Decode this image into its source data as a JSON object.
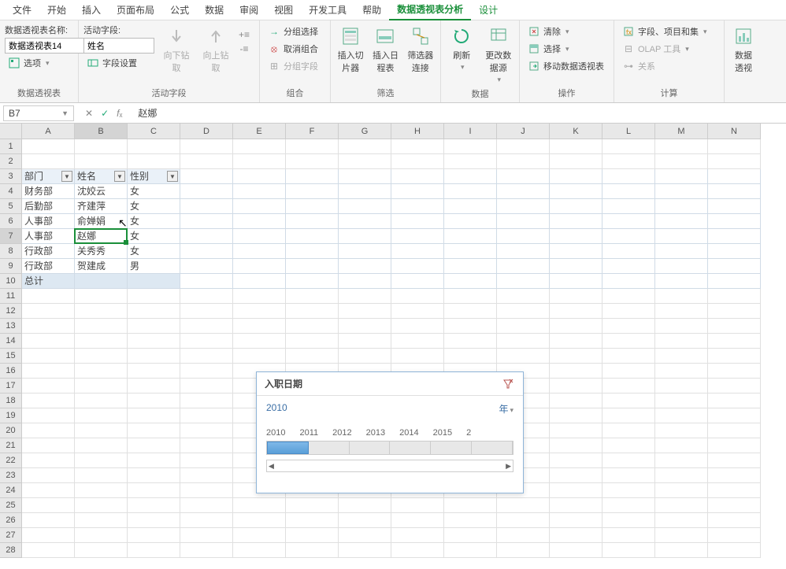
{
  "menu": [
    "文件",
    "开始",
    "插入",
    "页面布局",
    "公式",
    "数据",
    "审阅",
    "视图",
    "开发工具",
    "帮助",
    "数据透视表分析",
    "设计"
  ],
  "menu_active_index": 10,
  "ribbon": {
    "group1": {
      "label": "数据透视表",
      "name_lbl": "数据透视表名称:",
      "name_val": "数据透视表14",
      "options": "选项"
    },
    "group2": {
      "label": "活动字段",
      "field_lbl": "活动字段:",
      "field_val": "姓名",
      "settings": "字段设置",
      "drilldown": "向下钻取",
      "drillup": "向上钻取"
    },
    "group3": {
      "label": "组合",
      "group_sel": "分组选择",
      "ungroup": "取消组合",
      "group_field": "分组字段"
    },
    "group4": {
      "label": "筛选",
      "slicer": "插入切片器",
      "timeline": "插入日程表",
      "conn": "筛选器连接"
    },
    "group5": {
      "label": "数据",
      "refresh": "刷新",
      "change": "更改数据源"
    },
    "group6": {
      "label": "操作",
      "clear": "清除",
      "select": "选择",
      "move": "移动数据透视表"
    },
    "group7": {
      "label": "计算",
      "fields": "字段、项目和集",
      "olap": "OLAP 工具",
      "rel": "关系"
    },
    "group8": {
      "pivot": "数据透视"
    }
  },
  "namebox": "B7",
  "formula_val": "赵娜",
  "cols": [
    "A",
    "B",
    "C",
    "D",
    "E",
    "F",
    "G",
    "H",
    "I",
    "J",
    "K",
    "L",
    "M",
    "N"
  ],
  "rows_count": 28,
  "headers": {
    "dept": "部门",
    "name": "姓名",
    "gender": "性别"
  },
  "table": [
    {
      "dept": "财务部",
      "name": "沈姣云",
      "gender": "女"
    },
    {
      "dept": "后勤部",
      "name": "齐建萍",
      "gender": "女"
    },
    {
      "dept": "人事部",
      "name": "俞婵娟",
      "gender": "女"
    },
    {
      "dept": "人事部",
      "name": "赵娜",
      "gender": "女"
    },
    {
      "dept": "行政部",
      "name": "关秀秀",
      "gender": "女"
    },
    {
      "dept": "行政部",
      "name": "贺建成",
      "gender": "男"
    }
  ],
  "total": "总计",
  "active": {
    "row": 7,
    "col": "B"
  },
  "slicer": {
    "title": "入职日期",
    "period_val": "2010",
    "period_unit": "年",
    "years": [
      "2010",
      "2011",
      "2012",
      "2013",
      "2014",
      "2015",
      "2"
    ],
    "selected_index": 0
  }
}
